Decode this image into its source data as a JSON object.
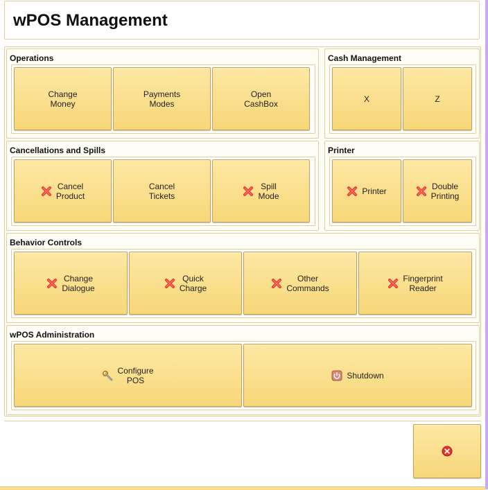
{
  "title": "wPOS Management",
  "colors": {
    "button_top": "#fde8a4",
    "button_bottom": "#f7d778",
    "border": "#e0cf9a",
    "error_red": "#e8342a"
  },
  "operations": {
    "title": "Operations",
    "buttons": [
      {
        "label": "Change\nMoney"
      },
      {
        "label": "Payments\nModes"
      },
      {
        "label": "Open\nCashBox"
      }
    ]
  },
  "cash": {
    "title": "Cash Management",
    "buttons": [
      {
        "label": "X"
      },
      {
        "label": "Z"
      }
    ]
  },
  "cancellations": {
    "title": "Cancellations and Spills",
    "buttons": [
      {
        "label": "Cancel\nProduct",
        "icon": "red-x-icon"
      },
      {
        "label": "Cancel\nTickets"
      },
      {
        "label": "Spill\nMode",
        "icon": "red-x-icon"
      }
    ]
  },
  "printer": {
    "title": "Printer",
    "buttons": [
      {
        "label": "Printer",
        "icon": "red-x-icon"
      },
      {
        "label": "Double\nPrinting",
        "icon": "red-x-icon"
      }
    ]
  },
  "behavior": {
    "title": "Behavior Controls",
    "buttons": [
      {
        "label": "Change\nDialogue",
        "icon": "red-x-icon"
      },
      {
        "label": "Quick\nCharge",
        "icon": "red-x-icon"
      },
      {
        "label": "Other\nCommands",
        "icon": "red-x-icon"
      },
      {
        "label": "Fingerprint\nReader",
        "icon": "red-x-icon"
      }
    ]
  },
  "admin": {
    "title": "wPOS Administration",
    "buttons": [
      {
        "label": "Configure\nPOS",
        "icon": "wrench-icon"
      },
      {
        "label": "Shutdown",
        "icon": "power-icon"
      }
    ]
  },
  "close_button": {
    "icon": "close-circle-icon"
  }
}
